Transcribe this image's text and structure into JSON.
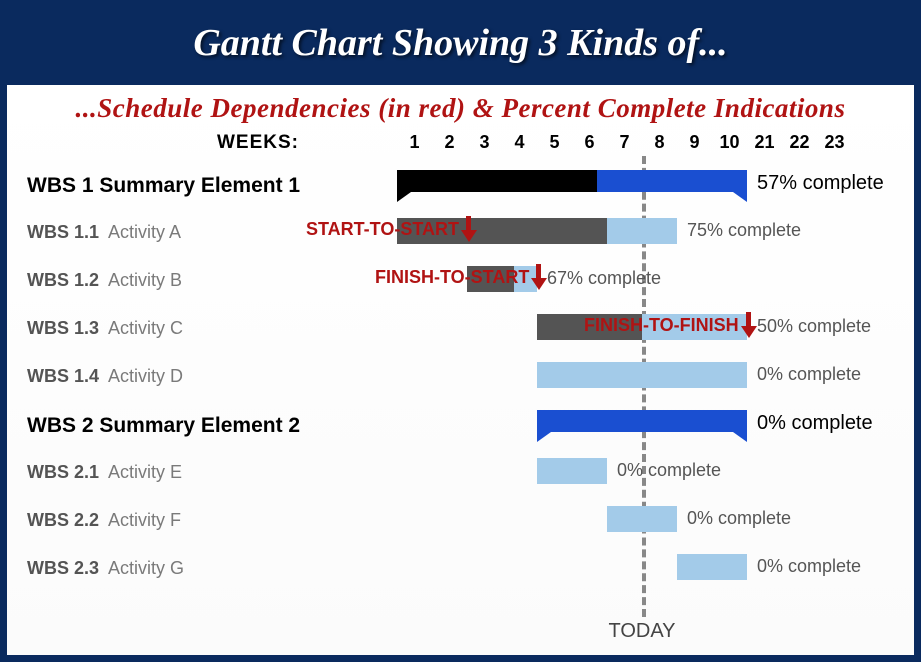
{
  "header": {
    "title": "Gantt Chart Showing 3 Kinds of...",
    "subtitle": "...Schedule Dependencies (in red) & Percent Complete Indications"
  },
  "axis": {
    "label": "WEEKS:",
    "ticks": [
      "1",
      "2",
      "3",
      "4",
      "5",
      "6",
      "7",
      "8",
      "9",
      "10",
      "21",
      "22",
      "23"
    ],
    "today_label": "TODAY",
    "today_week": 8
  },
  "dependencies": [
    {
      "name": "start-to-start",
      "label": "START-TO-START",
      "arrow_week": 3,
      "between": [
        "WBS 1.1",
        "WBS 1.2"
      ]
    },
    {
      "name": "finish-to-start",
      "label": "FINISH-TO-START",
      "arrow_week": 5,
      "between": [
        "WBS 1.2",
        "WBS 1.3"
      ]
    },
    {
      "name": "finish-to-finish",
      "label": "FINISH-TO-FINISH",
      "arrow_week": 11,
      "between": [
        "WBS 1.3",
        "WBS 1.4"
      ]
    }
  ],
  "rows": [
    {
      "id": "wbs1",
      "type": "summary",
      "wbs": "WBS 1",
      "name": "Summary Element 1",
      "start": 1,
      "end": 11,
      "pct": 57,
      "pct_label": "57% complete"
    },
    {
      "id": "wbs1.1",
      "type": "task",
      "wbs": "WBS 1.1",
      "name": "Activity A",
      "start": 1,
      "end": 9,
      "pct": 75,
      "pct_label": "75% complete"
    },
    {
      "id": "wbs1.2",
      "type": "task",
      "wbs": "WBS 1.2",
      "name": "Activity B",
      "start": 3,
      "end": 5,
      "pct": 67,
      "pct_label": "67% complete"
    },
    {
      "id": "wbs1.3",
      "type": "task",
      "wbs": "WBS 1.3",
      "name": "Activity C",
      "start": 5,
      "end": 11,
      "pct": 50,
      "pct_label": "50% complete"
    },
    {
      "id": "wbs1.4",
      "type": "task",
      "wbs": "WBS 1.4",
      "name": "Activity D",
      "start": 5,
      "end": 11,
      "pct": 0,
      "pct_label": "0% complete"
    },
    {
      "id": "wbs2",
      "type": "summary",
      "wbs": "WBS 2",
      "name": "Summary Element 2",
      "start": 5,
      "end": 11,
      "pct": 0,
      "pct_label": "0% complete"
    },
    {
      "id": "wbs2.1",
      "type": "task",
      "wbs": "WBS 2.1",
      "name": "Activity E",
      "start": 5,
      "end": 7,
      "pct": 0,
      "pct_label": "0% complete"
    },
    {
      "id": "wbs2.2",
      "type": "task",
      "wbs": "WBS 2.2",
      "name": "Activity F",
      "start": 7,
      "end": 9,
      "pct": 0,
      "pct_label": "0% complete"
    },
    {
      "id": "wbs2.3",
      "type": "task",
      "wbs": "WBS 2.3",
      "name": "Activity G",
      "start": 9,
      "end": 11,
      "pct": 0,
      "pct_label": "0% complete"
    }
  ],
  "chart_data": {
    "type": "bar",
    "title": "Gantt Chart Showing 3 Kinds of Schedule Dependencies & Percent Complete Indications",
    "xlabel": "WEEKS",
    "ylabel": "",
    "x_ticks": [
      1,
      2,
      3,
      4,
      5,
      6,
      7,
      8,
      9,
      10,
      21,
      22,
      23
    ],
    "series": [
      {
        "name": "WBS 1 Summary Element 1",
        "start": 1,
        "end": 11,
        "pct_complete": 57
      },
      {
        "name": "WBS 1.1 Activity A",
        "start": 1,
        "end": 9,
        "pct_complete": 75
      },
      {
        "name": "WBS 1.2 Activity B",
        "start": 3,
        "end": 5,
        "pct_complete": 67
      },
      {
        "name": "WBS 1.3 Activity C",
        "start": 5,
        "end": 11,
        "pct_complete": 50
      },
      {
        "name": "WBS 1.4 Activity D",
        "start": 5,
        "end": 11,
        "pct_complete": 0
      },
      {
        "name": "WBS 2 Summary Element 2",
        "start": 5,
        "end": 11,
        "pct_complete": 0
      },
      {
        "name": "WBS 2.1 Activity E",
        "start": 5,
        "end": 7,
        "pct_complete": 0
      },
      {
        "name": "WBS 2.2 Activity F",
        "start": 7,
        "end": 9,
        "pct_complete": 0
      },
      {
        "name": "WBS 2.3 Activity G",
        "start": 9,
        "end": 11,
        "pct_complete": 0
      }
    ],
    "today_marker": 8,
    "dependencies": [
      {
        "type": "start-to-start",
        "from": "WBS 1.1",
        "to": "WBS 1.2"
      },
      {
        "type": "finish-to-start",
        "from": "WBS 1.2",
        "to": "WBS 1.3"
      },
      {
        "type": "finish-to-finish",
        "from": "WBS 1.3",
        "to": "WBS 1.4"
      }
    ]
  },
  "colors": {
    "summary_done": "#000000",
    "summary_pending": "#1a4fd1",
    "task_done": "#545454",
    "task_pending": "#a3cbe9",
    "dependency": "#b01313"
  }
}
